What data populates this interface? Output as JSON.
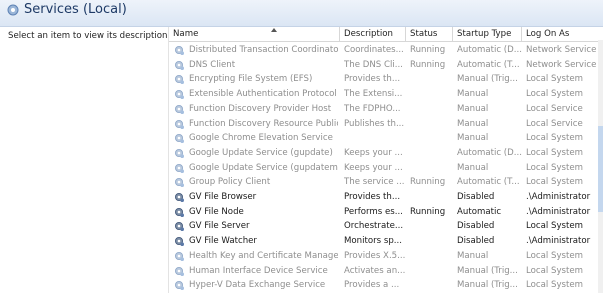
{
  "header": {
    "title": "Services (Local)",
    "icon": "services-gear-icon"
  },
  "left_pane": {
    "text": "Select an item to view its description."
  },
  "columns": [
    {
      "key": "name",
      "label": "Name"
    },
    {
      "key": "description",
      "label": "Description"
    },
    {
      "key": "status",
      "label": "Status"
    },
    {
      "key": "startup",
      "label": "Startup Type"
    },
    {
      "key": "logon",
      "label": "Log On As"
    }
  ],
  "rows": [
    {
      "name": "Distributed Transaction Coordinator",
      "description": "Coordinates...",
      "status": "Running",
      "startup": "Automatic (D...",
      "logon": "Network Service",
      "style": "dim"
    },
    {
      "name": "DNS Client",
      "description": "The DNS Cli...",
      "status": "Running",
      "startup": "Automatic (T...",
      "logon": "Network Service",
      "style": "dim"
    },
    {
      "name": "Encrypting File System (EFS)",
      "description": "Provides th...",
      "status": "",
      "startup": "Manual (Trig...",
      "logon": "Local System",
      "style": "dim"
    },
    {
      "name": "Extensible Authentication Protocol",
      "description": "The Extensi...",
      "status": "",
      "startup": "Manual",
      "logon": "Local System",
      "style": "dim"
    },
    {
      "name": "Function Discovery Provider Host",
      "description": "The FDPHO...",
      "status": "",
      "startup": "Manual",
      "logon": "Local Service",
      "style": "dim"
    },
    {
      "name": "Function Discovery Resource Public...",
      "description": "Publishes th...",
      "status": "",
      "startup": "Manual",
      "logon": "Local Service",
      "style": "dim"
    },
    {
      "name": "Google Chrome Elevation Service",
      "description": "",
      "status": "",
      "startup": "Manual",
      "logon": "Local System",
      "style": "dim"
    },
    {
      "name": "Google Update Service (gupdate)",
      "description": "Keeps your ...",
      "status": "",
      "startup": "Automatic (D...",
      "logon": "Local System",
      "style": "dim"
    },
    {
      "name": "Google Update Service (gupdatem)",
      "description": "Keeps your ...",
      "status": "",
      "startup": "Manual",
      "logon": "Local System",
      "style": "dim"
    },
    {
      "name": "Group Policy Client",
      "description": "The service ...",
      "status": "Running",
      "startup": "Automatic (T...",
      "logon": "Local System",
      "style": "dim"
    },
    {
      "name": "GV File Browser",
      "description": "Provides th...",
      "status": "",
      "startup": "Disabled",
      "logon": ".\\Administrator",
      "style": "dark"
    },
    {
      "name": "GV File Node",
      "description": "Performs es...",
      "status": "Running",
      "startup": "Automatic",
      "logon": ".\\Administrator",
      "style": "dark"
    },
    {
      "name": "GV File Server",
      "description": "Orchestrate...",
      "status": "",
      "startup": "Disabled",
      "logon": "Local System",
      "style": "dark"
    },
    {
      "name": "GV File Watcher",
      "description": "Monitors sp...",
      "status": "",
      "startup": "Disabled",
      "logon": ".\\Administrator",
      "style": "dark"
    },
    {
      "name": "Health Key and Certificate Manage...",
      "description": "Provides X.5...",
      "status": "",
      "startup": "Manual",
      "logon": "Local System",
      "style": "dim"
    },
    {
      "name": "Human Interface Device Service",
      "description": "Activates an...",
      "status": "",
      "startup": "Manual (Trig...",
      "logon": "Local System",
      "style": "dim"
    },
    {
      "name": "Hyper-V Data Exchange Service",
      "description": "Provides a ...",
      "status": "",
      "startup": "Manual (Trig...",
      "logon": "Local System",
      "style": "dim"
    }
  ],
  "icons": {
    "service_row": "gear-icon"
  },
  "colors": {
    "dim_text": "#8e8e8e",
    "dark_text": "#1a1a1a",
    "header_title": "#1e3a66"
  }
}
